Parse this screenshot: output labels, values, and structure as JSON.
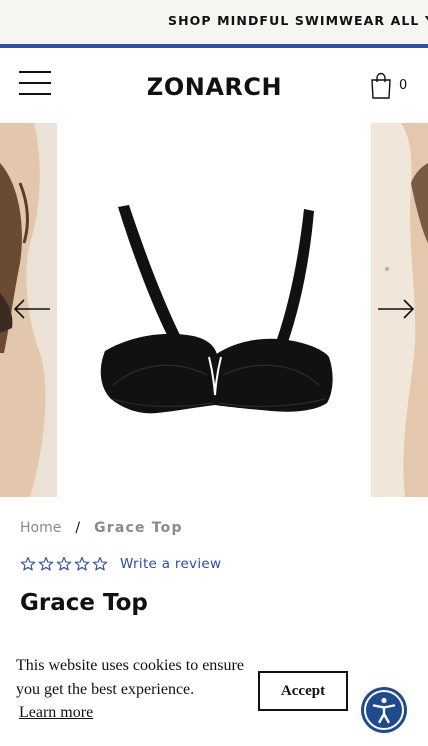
{
  "announcement": {
    "text": "SHOP MINDFUL SWIMWEAR ALL YEAR"
  },
  "header": {
    "logo_text": "ZONARCH",
    "cart_count": "0",
    "menu_icon": "hamburger-menu-icon",
    "cart_icon": "shopping-bag-icon"
  },
  "colors": {
    "accent_rule": "#2f4ea3",
    "link": "#2f4ea3",
    "accessibility_button": "#1f4a8c",
    "product_swim": "#111111"
  },
  "gallery": {
    "prev_arrow_icon": "arrow-left-icon",
    "next_arrow_icon": "arrow-right-icon",
    "main_image_subject": "black underwire bikini top"
  },
  "breadcrumb": {
    "home": "Home",
    "separator": "/",
    "current": "Grace Top"
  },
  "rating": {
    "stars_filled": 0,
    "stars_total": 5,
    "review_link": "Write a review"
  },
  "product": {
    "title": "Grace Top"
  },
  "cookie_banner": {
    "message": "This website uses cookies to ensure you get the best experience.",
    "learn_more": "Learn more",
    "accept": "Accept"
  },
  "accessibility": {
    "icon": "accessibility-person-icon"
  }
}
